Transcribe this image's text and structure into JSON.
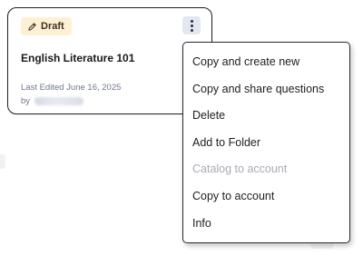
{
  "card": {
    "badge": {
      "label": "Draft",
      "icon": "pencil-icon"
    },
    "title": "English Literature 101",
    "last_edited": "Last Edited June 16, 2025",
    "by_label": "by",
    "more_icon": "kebab-menu-icon"
  },
  "menu": {
    "items": [
      {
        "label": "Copy and create new",
        "disabled": false
      },
      {
        "label": "Copy and share questions",
        "disabled": false
      },
      {
        "label": "Delete",
        "disabled": false
      },
      {
        "label": "Add to Folder",
        "disabled": false
      },
      {
        "label": "Catalog to account",
        "disabled": true
      },
      {
        "label": "Copy to account",
        "disabled": false
      },
      {
        "label": "Info",
        "disabled": false
      }
    ]
  },
  "colors": {
    "badge_bg": "#fdf0d3",
    "kebab_bg": "#e3e7f0",
    "meta_text": "#6f7890",
    "disabled_text": "#a9abb3"
  }
}
